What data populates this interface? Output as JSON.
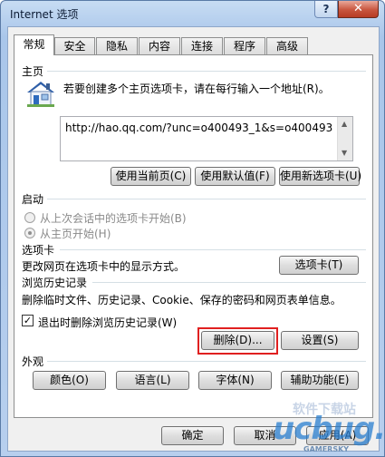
{
  "window": {
    "title": "Internet 选项",
    "help_label": "?",
    "close_label": "✕"
  },
  "tabs": [
    {
      "label": "常规"
    },
    {
      "label": "安全"
    },
    {
      "label": "隐私"
    },
    {
      "label": "内容"
    },
    {
      "label": "连接"
    },
    {
      "label": "程序"
    },
    {
      "label": "高级"
    }
  ],
  "home": {
    "title": "主页",
    "instruction": "若要创建多个主页选项卡，请在每行输入一个地址(R)。",
    "url": "http://hao.qq.com/?unc=o400493_1&s=o400493",
    "use_current": "使用当前页(C)",
    "use_default": "使用默认值(F)",
    "use_new_tab": "使用新选项卡(U)"
  },
  "startup": {
    "title": "启动",
    "option_last_session": "从上次会话中的选项卡开始(B)",
    "option_home": "从主页开始(H)",
    "selected": "从主页开始(H)"
  },
  "tabs_section": {
    "title": "选项卡",
    "description": "更改网页在选项卡中的显示方式。",
    "button": "选项卡(T)"
  },
  "history": {
    "title": "浏览历史记录",
    "description": "删除临时文件、历史记录、Cookie、保存的密码和网页表单信息。",
    "checkbox_label": "退出时删除浏览历史记录(W)",
    "checkbox_checked": true,
    "delete_button": "删除(D)...",
    "settings_button": "设置(S)"
  },
  "appearance": {
    "title": "外观",
    "colors": "颜色(O)",
    "languages": "语言(L)",
    "fonts": "字体(N)",
    "accessibility": "辅助功能(E)"
  },
  "footer": {
    "ok": "确定",
    "cancel": "取消",
    "apply": "应用(A)"
  },
  "watermark": {
    "cn": "软件下载站",
    "logo": "ucbug.cc",
    "en": "GAMERSKY"
  },
  "colors": {
    "highlight": "#e02020",
    "close_button": "#c8553e"
  }
}
